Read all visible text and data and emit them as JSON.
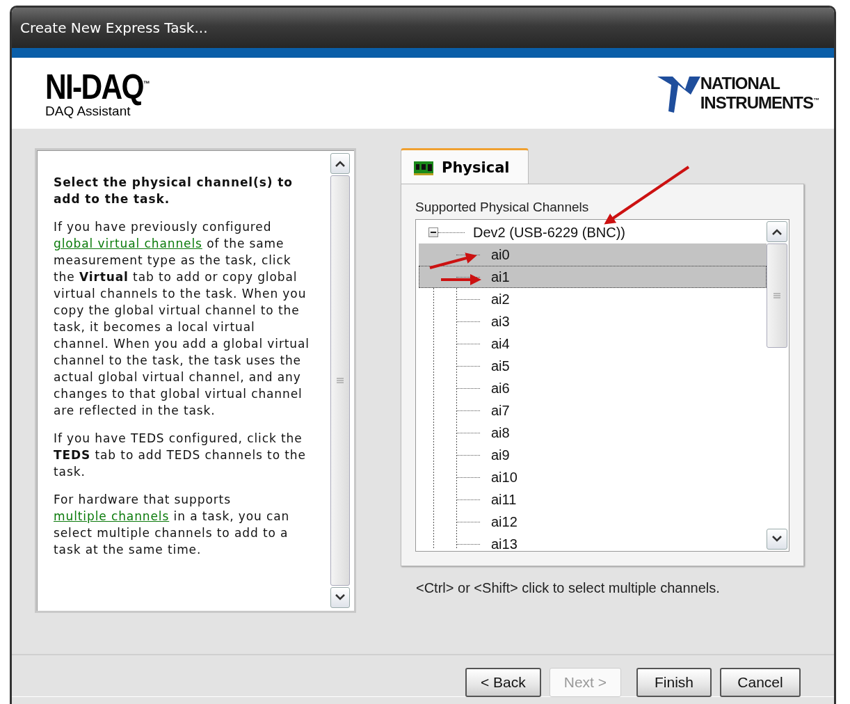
{
  "window": {
    "title": "Create New Express Task..."
  },
  "header": {
    "product": "NI-DAQ$^{™}$",
    "subtitle": "DAQ Assistant",
    "brand_line_1": "NATIONAL",
    "brand_line_2": "INSTRUMENTS$^{™}$"
  },
  "help": {
    "paragraphs": [
      [
        {
          "kind": "bold",
          "text": "Select the physical channel(s) to add to the task."
        }
      ],
      [
        {
          "kind": "text",
          "text": "If you have previously configured "
        },
        {
          "kind": "link",
          "text": "global virtual channels"
        },
        {
          "kind": "text",
          "text": " of the same measurement type as the task, click the **Virtual** tab to add or copy global virtual channels to the task. When you copy the global virtual channel to the task, it becomes a local virtual channel. When you add a global virtual channel to the task, the task uses the actual global virtual channel, and any changes to that global virtual channel are reflected in the task."
        }
      ],
      [
        {
          "kind": "text",
          "text": "If you have TEDS configured, click the **TEDS** tab to add TEDS channels to the task."
        }
      ],
      [
        {
          "kind": "text",
          "text": "For hardware that supports "
        },
        {
          "kind": "link",
          "text": "multiple channels"
        },
        {
          "kind": "text",
          "text": " in a task, you can select multiple channels to add to a task at the same time."
        }
      ]
    ]
  },
  "tabs": [
    {
      "label": "Physical",
      "selected": true
    }
  ],
  "channels": {
    "label": "Supported Physical Channels",
    "tree": [
      {
        "label": "Dev2  (USB-6229 (BNC))",
        "expanded": true,
        "children": [
          {
            "label": "ai0",
            "selected": true
          },
          {
            "label": "ai1",
            "selected": true
          },
          {
            "label": "ai2",
            "selected": false
          },
          {
            "label": "ai3",
            "selected": false
          },
          {
            "label": "ai4",
            "selected": false
          },
          {
            "label": "ai5",
            "selected": false
          },
          {
            "label": "ai6",
            "selected": false
          },
          {
            "label": "ai7",
            "selected": false
          },
          {
            "label": "ai8",
            "selected": false
          },
          {
            "label": "ai9",
            "selected": false
          },
          {
            "label": "ai10",
            "selected": false
          },
          {
            "label": "ai11",
            "selected": false
          },
          {
            "label": "ai12",
            "selected": false
          },
          {
            "label": "ai13",
            "selected": false
          }
        ]
      }
    ]
  },
  "hint": "<Ctrl> or <Shift> click to select multiple channels.",
  "buttons": [
    {
      "label": "< Back",
      "disabled": false
    },
    {
      "label": "Next >",
      "disabled": true
    },
    {
      "label": "Finish",
      "disabled": false
    },
    {
      "label": "Cancel",
      "disabled": false
    }
  ]
}
